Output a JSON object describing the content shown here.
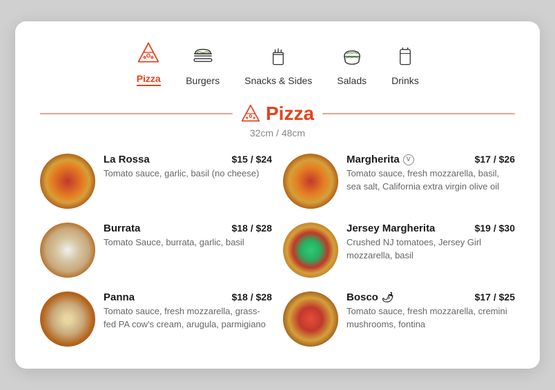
{
  "nav": {
    "items": [
      {
        "id": "pizza",
        "label": "Pizza",
        "active": true
      },
      {
        "id": "burgers",
        "label": "Burgers",
        "active": false
      },
      {
        "id": "snacks",
        "label": "Snacks & Sides",
        "active": false
      },
      {
        "id": "salads",
        "label": "Salads",
        "active": false
      },
      {
        "id": "drinks",
        "label": "Drinks",
        "active": false
      }
    ]
  },
  "section": {
    "title": "Pizza",
    "subtitle": "32cm / 48cm"
  },
  "menu": {
    "items": [
      {
        "id": "la-rossa",
        "name": "La Rossa",
        "price": "$15 / $24",
        "desc": "Tomato sauce, garlic, basil (no cheese)",
        "imgClass": "pizza-la-rossa",
        "badge": null,
        "col": 0
      },
      {
        "id": "margherita",
        "name": "Margherita",
        "price": "$17 / $26",
        "desc": "Tomato sauce, fresh mozzarella, basil, sea salt, California extra virgin olive oil",
        "imgClass": "pizza-margherita",
        "badge": "V",
        "col": 1
      },
      {
        "id": "burrata",
        "name": "Burrata",
        "price": "$18 / $28",
        "desc": "Tomato Sauce, burrata, garlic, basil",
        "imgClass": "pizza-burrata",
        "badge": null,
        "col": 0
      },
      {
        "id": "jersey-margherita",
        "name": "Jersey Margherita",
        "price": "$19 / $30",
        "desc": "Crushed NJ tomatoes, Jersey Girl mozzarella, basil",
        "imgClass": "pizza-jersey",
        "badge": null,
        "col": 1
      },
      {
        "id": "panna",
        "name": "Panna",
        "price": "$18 / $28",
        "desc": "Tomato sauce, fresh mozzarella, grass-fed PA cow's cream, arugula, parmigiano",
        "imgClass": "pizza-panna",
        "badge": null,
        "col": 0
      },
      {
        "id": "bosco",
        "name": "Bosco",
        "price": "$17 / $25",
        "desc": "Tomato sauce, fresh mozzarella, cremini mushrooms, fontina",
        "imgClass": "pizza-bosco",
        "badge": "spicy",
        "col": 1
      }
    ]
  },
  "colors": {
    "accent": "#e8401c"
  }
}
